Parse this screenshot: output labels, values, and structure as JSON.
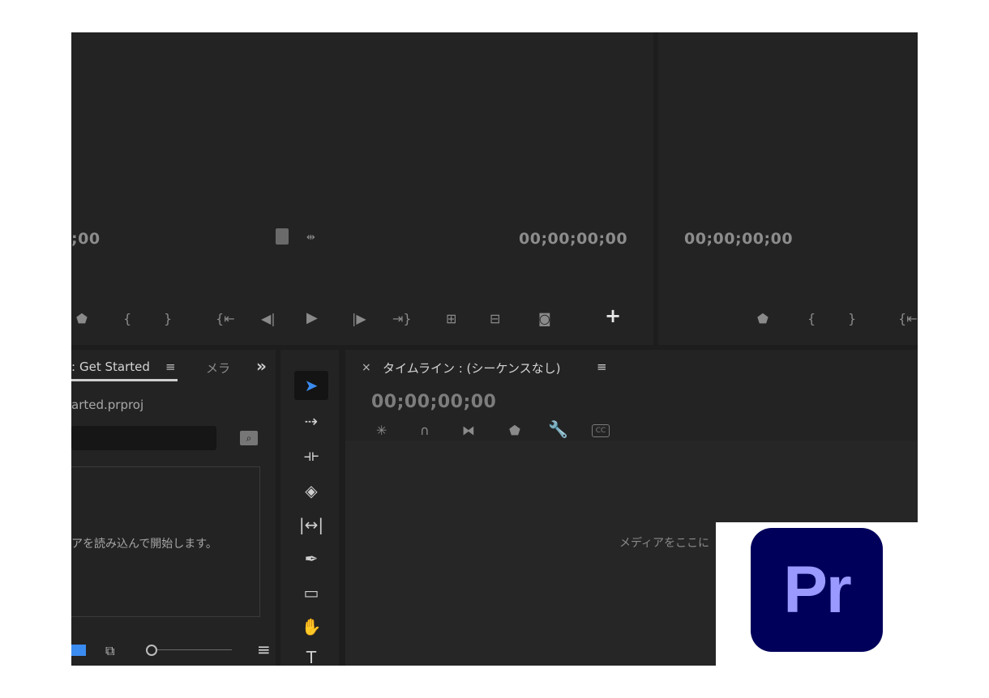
{
  "source_monitor": {
    "timecode_left": ";00",
    "timecode_right": "00;00;00;00"
  },
  "program_monitor": {
    "timecode": "00;00;00;00"
  },
  "project_panel": {
    "tab_prefix": ":",
    "tab_label": "Get Started",
    "tab_next": "メラ",
    "more": "»",
    "filename": "arted.prproj",
    "empty_message": "アを読み込んで開始します。"
  },
  "timeline": {
    "close": "×",
    "title": "タイムライン : (シーケンスなし)",
    "timecode": "00;00;00;00",
    "drop_message": "メディアをここに"
  },
  "logo": {
    "text": "Pr"
  }
}
